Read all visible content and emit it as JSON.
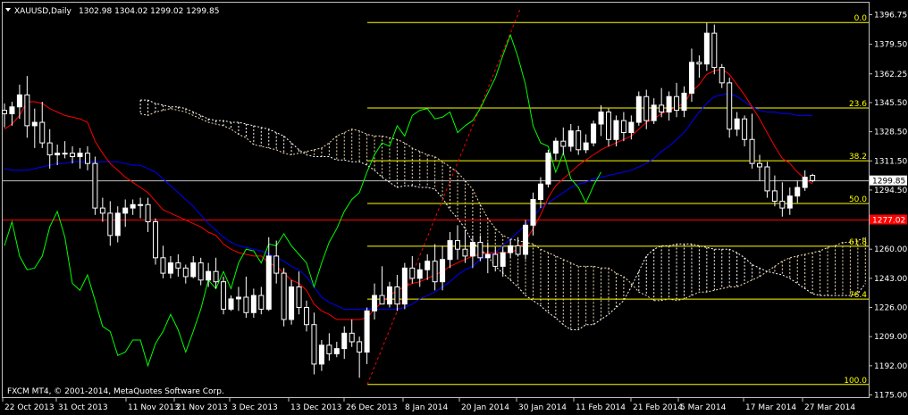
{
  "header": {
    "symbol": "XAUUSD,Daily",
    "ohlc": "1302.98 1304.02 1299.02 1299.85",
    "menu_icon": "triangle-down-icon"
  },
  "footer": {
    "copyright": "FXCM MT4, © 2001-2014, MetaQuotes Software Corp."
  },
  "colors": {
    "background": "#000000",
    "axis": "#c0c0c0",
    "bull_candle": "#ffffff",
    "bear_candle": "#000000",
    "tenkan": "#ff0000",
    "kijun": "#0000ff",
    "chikou": "#00ff00",
    "cloud_bull": "#f5deb3",
    "cloud_bear": "#ffffff",
    "fib": "#ffff00",
    "fib_trend": "#ff0000",
    "bid_line": "#c0c0c0",
    "alert_line": "#ff0000",
    "alert_label_bg": "#ff0000"
  },
  "chart_data": {
    "type": "candlestick",
    "instrument": "XAUUSD",
    "timeframe": "Daily",
    "ylim": [
      1175,
      1396.75
    ],
    "price_ticks": [
      "1396.75",
      "1379.50",
      "1362.25",
      "1345.50",
      "1328.50",
      "1311.50",
      "1294.50",
      "1277.50",
      "1260.00",
      "1243.00",
      "1226.00",
      "1209.00",
      "1192.00",
      "1175.00"
    ],
    "x_labels": [
      "22 Oct 2013",
      "31 Oct 2013",
      "11 Nov 2013",
      "21 Nov 2013",
      "3 Dec 2013",
      "13 Dec 2013",
      "26 Dec 2013",
      "8 Jan 2014",
      "20 Jan 2014",
      "30 Jan 2014",
      "11 Feb 2014",
      "21 Feb 2014",
      "5 Mar 2014",
      "17 Mar 2014",
      "27 Mar 2014"
    ],
    "bid_price": "1299.85",
    "alert_price": "1277.02",
    "fibonacci": {
      "high": 1392.2,
      "low": 1181.1,
      "levels": [
        {
          "label": "0.0",
          "ratio": 0.0
        },
        {
          "label": "23.6",
          "ratio": 0.236
        },
        {
          "label": "38.2",
          "ratio": 0.382
        },
        {
          "label": "50.0",
          "ratio": 0.5
        },
        {
          "label": "61.8",
          "ratio": 0.618
        },
        {
          "label": "76.4",
          "ratio": 0.764
        },
        {
          "label": "100.0",
          "ratio": 1.0
        }
      ]
    },
    "ohlc": [
      [
        1341,
        1345,
        1331,
        1339
      ],
      [
        1339,
        1346,
        1332,
        1343
      ],
      [
        1343,
        1356,
        1336,
        1350
      ],
      [
        1350,
        1361,
        1325,
        1332
      ],
      [
        1332,
        1342,
        1319,
        1334
      ],
      [
        1334,
        1346,
        1319,
        1322
      ],
      [
        1322,
        1330,
        1307,
        1315
      ],
      [
        1315,
        1321,
        1309,
        1316
      ],
      [
        1316,
        1323,
        1313,
        1316
      ],
      [
        1316,
        1320,
        1310,
        1314
      ],
      [
        1314,
        1319,
        1307,
        1316
      ],
      [
        1316,
        1320,
        1306,
        1310
      ],
      [
        1310,
        1314,
        1280,
        1284
      ],
      [
        1284,
        1290,
        1276,
        1281
      ],
      [
        1281,
        1288,
        1262,
        1268
      ],
      [
        1268,
        1285,
        1264,
        1281
      ],
      [
        1281,
        1289,
        1273,
        1284
      ],
      [
        1284,
        1289,
        1280,
        1286
      ],
      [
        1286,
        1290,
        1278,
        1286
      ],
      [
        1286,
        1290,
        1270,
        1276
      ],
      [
        1276,
        1278,
        1251,
        1255
      ],
      [
        1255,
        1262,
        1243,
        1246
      ],
      [
        1246,
        1256,
        1243,
        1252
      ],
      [
        1252,
        1257,
        1244,
        1249
      ],
      [
        1249,
        1251,
        1240,
        1244
      ],
      [
        1244,
        1256,
        1243,
        1252
      ],
      [
        1252,
        1255,
        1239,
        1242
      ],
      [
        1242,
        1252,
        1238,
        1247
      ],
      [
        1247,
        1255,
        1237,
        1241
      ],
      [
        1241,
        1244,
        1222,
        1225
      ],
      [
        1225,
        1233,
        1224,
        1231
      ],
      [
        1231,
        1238,
        1224,
        1232
      ],
      [
        1232,
        1244,
        1220,
        1223
      ],
      [
        1223,
        1237,
        1220,
        1233
      ],
      [
        1233,
        1238,
        1222,
        1225
      ],
      [
        1225,
        1267,
        1224,
        1256
      ],
      [
        1256,
        1265,
        1240,
        1246
      ],
      [
        1246,
        1249,
        1215,
        1219
      ],
      [
        1219,
        1242,
        1216,
        1238
      ],
      [
        1238,
        1247,
        1222,
        1226
      ],
      [
        1226,
        1230,
        1212,
        1216
      ],
      [
        1216,
        1223,
        1187,
        1193
      ],
      [
        1193,
        1207,
        1189,
        1204
      ],
      [
        1204,
        1211,
        1195,
        1199
      ],
      [
        1199,
        1206,
        1197,
        1202
      ],
      [
        1202,
        1215,
        1196,
        1211
      ],
      [
        1211,
        1219,
        1203,
        1206
      ],
      [
        1206,
        1209,
        1185,
        1200
      ],
      [
        1200,
        1226,
        1193,
        1224
      ],
      [
        1224,
        1240,
        1219,
        1233
      ],
      [
        1233,
        1250,
        1229,
        1228
      ],
      [
        1228,
        1241,
        1226,
        1238
      ],
      [
        1238,
        1245,
        1224,
        1228
      ],
      [
        1228,
        1252,
        1225,
        1249
      ],
      [
        1249,
        1256,
        1240,
        1243
      ],
      [
        1243,
        1252,
        1238,
        1248
      ],
      [
        1248,
        1257,
        1242,
        1253
      ],
      [
        1253,
        1263,
        1236,
        1241
      ],
      [
        1241,
        1262,
        1236,
        1254
      ],
      [
        1254,
        1270,
        1249,
        1265
      ],
      [
        1265,
        1274,
        1254,
        1260
      ],
      [
        1260,
        1271,
        1252,
        1256
      ],
      [
        1256,
        1268,
        1249,
        1264
      ],
      [
        1264,
        1268,
        1253,
        1255
      ],
      [
        1255,
        1264,
        1246,
        1257
      ],
      [
        1257,
        1261,
        1247,
        1250
      ],
      [
        1250,
        1261,
        1244,
        1258
      ],
      [
        1258,
        1266,
        1255,
        1262
      ],
      [
        1262,
        1267,
        1256,
        1257
      ],
      [
        1257,
        1277,
        1254,
        1274
      ],
      [
        1274,
        1293,
        1268,
        1289
      ],
      [
        1289,
        1302,
        1284,
        1298
      ],
      [
        1298,
        1318,
        1296,
        1316
      ],
      [
        1316,
        1325,
        1312,
        1323
      ],
      [
        1323,
        1331,
        1315,
        1320
      ],
      [
        1320,
        1333,
        1317,
        1329
      ],
      [
        1329,
        1332,
        1315,
        1318
      ],
      [
        1318,
        1327,
        1316,
        1322
      ],
      [
        1322,
        1335,
        1320,
        1333
      ],
      [
        1333,
        1344,
        1326,
        1340
      ],
      [
        1340,
        1342,
        1320,
        1324
      ],
      [
        1324,
        1338,
        1320,
        1335
      ],
      [
        1335,
        1340,
        1323,
        1328
      ],
      [
        1328,
        1338,
        1324,
        1334
      ],
      [
        1334,
        1352,
        1332,
        1349
      ],
      [
        1349,
        1353,
        1330,
        1335
      ],
      [
        1335,
        1348,
        1333,
        1344
      ],
      [
        1344,
        1354,
        1337,
        1340
      ],
      [
        1340,
        1352,
        1335,
        1349
      ],
      [
        1349,
        1357,
        1337,
        1341
      ],
      [
        1341,
        1355,
        1337,
        1351
      ],
      [
        1351,
        1377,
        1346,
        1369
      ],
      [
        1369,
        1373,
        1360,
        1368
      ],
      [
        1368,
        1392,
        1364,
        1386
      ],
      [
        1386,
        1391,
        1362,
        1366
      ],
      [
        1366,
        1368,
        1354,
        1357
      ],
      [
        1357,
        1360,
        1325,
        1330
      ],
      [
        1330,
        1340,
        1326,
        1336
      ],
      [
        1336,
        1338,
        1320,
        1324
      ],
      [
        1324,
        1339,
        1307,
        1310
      ],
      [
        1310,
        1315,
        1300,
        1308
      ],
      [
        1308,
        1311,
        1290,
        1294
      ],
      [
        1294,
        1303,
        1285,
        1288
      ],
      [
        1288,
        1299,
        1279,
        1284
      ],
      [
        1284,
        1296,
        1280,
        1291
      ],
      [
        1291,
        1300,
        1287,
        1296
      ],
      [
        1296,
        1306,
        1294,
        1302
      ],
      [
        1303,
        1304,
        1299,
        1300
      ]
    ],
    "tenkan": [
      1330,
      1333,
      1338,
      1346,
      1346,
      1345,
      1342,
      1340,
      1338,
      1337,
      1336,
      1334,
      1323,
      1316,
      1310,
      1306,
      1302,
      1299,
      1296,
      1293,
      1288,
      1283,
      1281,
      1279,
      1277,
      1275,
      1273,
      1270,
      1268,
      1263,
      1260,
      1258,
      1257,
      1256,
      1256,
      1252,
      1250,
      1246,
      1242,
      1240,
      1236,
      1228,
      1224,
      1222,
      1219,
      1219,
      1219,
      1219,
      1220,
      1225,
      1229,
      1233,
      1236,
      1238,
      1240,
      1241,
      1243,
      1245,
      1247,
      1250,
      1252,
      1254,
      1256,
      1257,
      1258,
      1258,
      1258,
      1258,
      1260,
      1265,
      1272,
      1280,
      1290,
      1297,
      1301,
      1305,
      1309,
      1312,
      1315,
      1318,
      1320,
      1322,
      1324,
      1326,
      1330,
      1334,
      1336,
      1339,
      1341,
      1343,
      1345,
      1352,
      1356,
      1362,
      1364,
      1365,
      1362,
      1356,
      1350,
      1343,
      1336,
      1328,
      1320,
      1313,
      1310,
      1305,
      1301,
      1298
    ],
    "kijun": [
      1307,
      1306,
      1306,
      1306,
      1307,
      1308,
      1309,
      1310,
      1310,
      1311,
      1311,
      1311,
      1311,
      1311,
      1311,
      1311,
      1310,
      1309,
      1309,
      1307,
      1305,
      1301,
      1297,
      1293,
      1289,
      1285,
      1280,
      1275,
      1271,
      1267,
      1264,
      1262,
      1261,
      1260,
      1259,
      1257,
      1255,
      1253,
      1250,
      1248,
      1244,
      1238,
      1232,
      1229,
      1227,
      1225,
      1225,
      1225,
      1225,
      1225,
      1225,
      1225,
      1225,
      1226,
      1228,
      1231,
      1233,
      1235,
      1238,
      1241,
      1245,
      1248,
      1250,
      1254,
      1256,
      1258,
      1262,
      1266,
      1270,
      1274,
      1279,
      1284,
      1287,
      1290,
      1293,
      1296,
      1298,
      1299,
      1301,
      1302,
      1303,
      1304,
      1305,
      1306,
      1308,
      1310,
      1313,
      1317,
      1320,
      1324,
      1328,
      1334,
      1340,
      1345,
      1349,
      1350,
      1351,
      1349,
      1346,
      1343,
      1341,
      1340,
      1340,
      1339,
      1339,
      1338,
      1338,
      1338
    ],
    "chikou": [
      1262,
      1276,
      1256,
      1248,
      1249,
      1256,
      1273,
      1282,
      1267,
      1240,
      1236,
      1245,
      1230,
      1215,
      1212,
      1198,
      1200,
      1207,
      1207,
      1192,
      1205,
      1212,
      1222,
      1213,
      1200,
      1212,
      1225,
      1242,
      1237,
      1247,
      1237,
      1252,
      1260,
      1259,
      1252,
      1263,
      1262,
      1269,
      1262,
      1257,
      1252,
      1238,
      1252,
      1264,
      1272,
      1282,
      1289,
      1293,
      1305,
      1315,
      1322,
      1320,
      1332,
      1326,
      1338,
      1341,
      1342,
      1336,
      1337,
      1340,
      1328,
      1332,
      1335,
      1342,
      1351,
      1360,
      1373,
      1385,
      1372,
      1356,
      1332,
      1322,
      1320,
      1305,
      1316,
      1301,
      1296,
      1287,
      1297,
      1305
    ],
    "span_a": [
      1339,
      1338,
      1340,
      1341,
      1342,
      1341,
      1340,
      1338,
      1336,
      1334,
      1333,
      1332,
      1330,
      1327,
      1325,
      1321,
      1320,
      1319,
      1318,
      1316,
      1315,
      1316,
      1317,
      1318,
      1319,
      1322,
      1326,
      1328,
      1330,
      1329,
      1327,
      1326,
      1326,
      1325,
      1324,
      1322,
      1319,
      1317,
      1315,
      1314,
      1311,
      1308,
      1305,
      1300,
      1295,
      1286,
      1278,
      1272,
      1268,
      1266,
      1265,
      1264,
      1263,
      1260,
      1258,
      1256,
      1254,
      1252,
      1250,
      1250,
      1250,
      1249,
      1249,
      1246,
      1244,
      1240,
      1235,
      1233,
      1230,
      1230,
      1231,
      1230,
      1231,
      1233,
      1235,
      1235,
      1236,
      1237,
      1238,
      1238,
      1240,
      1242,
      1244,
      1247,
      1250,
      1253,
      1255,
      1256,
      1257,
      1258,
      1259,
      1261,
      1262,
      1264,
      1264,
      1265,
      1267,
      1267,
      1267,
      1267,
      1267,
      1267,
      1267,
      1267,
      1267,
      1267,
      1267,
      1267,
      1267,
      1272,
      1277,
      1283,
      1289,
      1293,
      1295,
      1297
    ],
    "span_b": [
      1347,
      1347,
      1345,
      1344,
      1343,
      1343,
      1342,
      1340,
      1338,
      1336,
      1335,
      1335,
      1334,
      1334,
      1333,
      1332,
      1331,
      1330,
      1328,
      1326,
      1322,
      1318,
      1315,
      1314,
      1314,
      1314,
      1312,
      1312,
      1311,
      1311,
      1309,
      1306,
      1302,
      1299,
      1296,
      1297,
      1297,
      1296,
      1296,
      1295,
      1290,
      1283,
      1278,
      1272,
      1264,
      1260,
      1256,
      1250,
      1246,
      1242,
      1238,
      1233,
      1230,
      1227,
      1223,
      1220,
      1216,
      1213,
      1213,
      1216,
      1216,
      1219,
      1222,
      1226,
      1230,
      1238,
      1247,
      1256,
      1260,
      1262,
      1262,
      1263,
      1263,
      1263,
      1262,
      1261,
      1260,
      1260,
      1260,
      1258,
      1255,
      1251,
      1249,
      1247,
      1246,
      1245,
      1243,
      1240,
      1237,
      1234,
      1233,
      1233,
      1233,
      1233,
      1233,
      1234,
      1240,
      1245,
      1250,
      1255,
      1260,
      1264,
      1267,
      1270,
      1274,
      1277,
      1280,
      1286,
      1291,
      1294,
      1296,
      1298,
      1299,
      1300,
      1300,
      1300
    ]
  }
}
